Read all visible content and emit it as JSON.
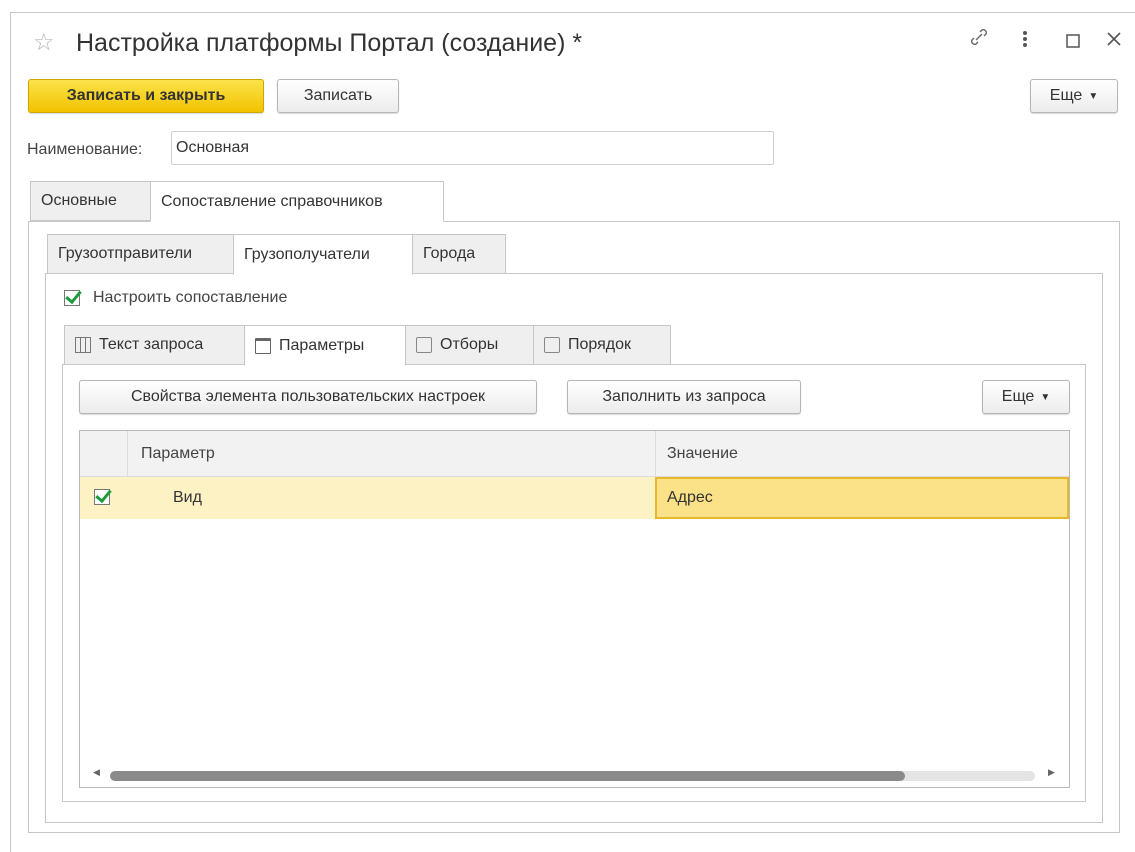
{
  "window": {
    "title": "Настройка платформы Портал (создание) *",
    "icons": [
      "star-icon",
      "link-icon",
      "more-vertical-icon",
      "maximize-icon",
      "close-icon"
    ]
  },
  "toolbar": {
    "save_close_label": "Записать и закрыть",
    "save_label": "Записать",
    "more_label": "Еще"
  },
  "name_field": {
    "label": "Наименование:",
    "value": "Основная"
  },
  "main_tabs": [
    {
      "label": "Основные",
      "active": false
    },
    {
      "label": "Сопоставление справочников",
      "active": true
    }
  ],
  "sub_tabs": [
    {
      "label": "Грузоотправители",
      "active": false
    },
    {
      "label": "Грузополучатели",
      "active": true
    },
    {
      "label": "Города",
      "active": false
    }
  ],
  "configure_mapping": {
    "label": "Настроить сопоставление",
    "checked": true
  },
  "query_tabs": [
    {
      "label": "Текст запроса",
      "icon": "table-icon",
      "active": false
    },
    {
      "label": "Параметры",
      "icon": "parameters-icon",
      "active": true
    },
    {
      "label": "Отборы",
      "icon": "filter-icon",
      "active": false
    },
    {
      "label": "Порядок",
      "icon": "sort-order-icon",
      "active": false
    }
  ],
  "params_toolbar": {
    "properties_label": "Свойства элемента пользовательских настроек",
    "fill_label": "Заполнить из запроса",
    "more_label": "Еще"
  },
  "table": {
    "columns": [
      "Параметр",
      "Значение"
    ],
    "rows": [
      {
        "checked": true,
        "parameter": "Вид",
        "value": "Адрес"
      }
    ]
  },
  "colors": {
    "primary_button": "#f2c300",
    "selected_row": "#fdf2c3",
    "selected_cell": "#fbe188",
    "check_mark": "#1f9b3e"
  }
}
